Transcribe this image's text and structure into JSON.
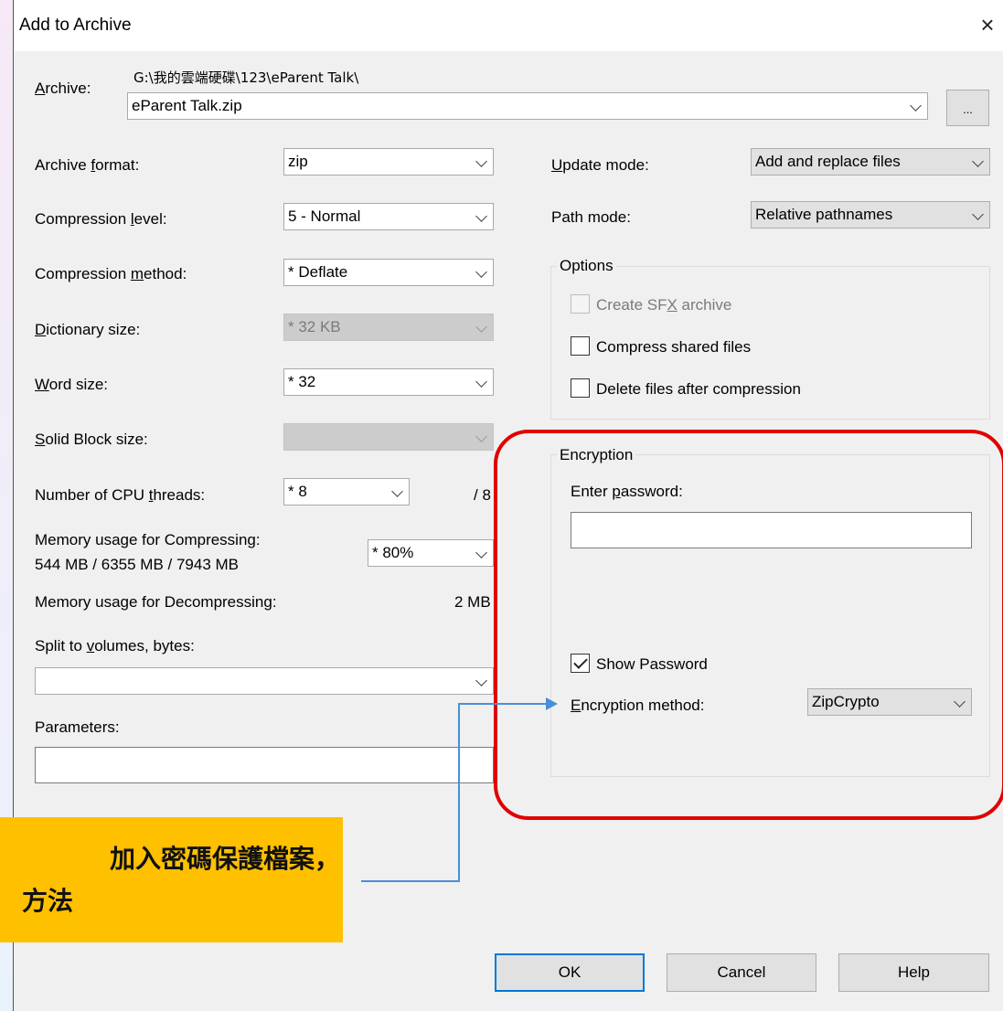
{
  "window": {
    "title": "Add to Archive",
    "close_glyph": "×"
  },
  "archive": {
    "label": "Archive:",
    "path": "G:\\我的雲端硬碟\\123\\eParent Talk\\",
    "filename": "eParent Talk.zip",
    "browse_label": "..."
  },
  "left": {
    "archive_format": {
      "label": "Archive format:",
      "value": "zip"
    },
    "compression_level": {
      "label": "Compression level:",
      "value": "5 - Normal"
    },
    "compression_method": {
      "label": "Compression method:",
      "value": "* Deflate"
    },
    "dictionary_size": {
      "label": "Dictionary size:",
      "value": "* 32 KB"
    },
    "word_size": {
      "label": "Word size:",
      "value": "* 32"
    },
    "solid_block_size": {
      "label": "Solid Block size:",
      "value": ""
    },
    "cpu_threads": {
      "label": "Number of CPU threads:",
      "value": "* 8",
      "max": "/ 8"
    },
    "memory_compress": {
      "label": "Memory usage for Compressing:",
      "detail": "544 MB / 6355 MB / 7943 MB",
      "value": "* 80%"
    },
    "memory_decompress": {
      "label": "Memory usage for Decompressing:",
      "value": "2 MB"
    },
    "split_volumes": {
      "label": "Split to volumes, bytes:",
      "value": ""
    },
    "parameters": {
      "label": "Parameters:",
      "value": ""
    }
  },
  "right": {
    "update_mode": {
      "label": "Update mode:",
      "value": "Add and replace files"
    },
    "path_mode": {
      "label": "Path mode:",
      "value": "Relative pathnames"
    },
    "options": {
      "title": "Options",
      "create_sfx": "Create SFX archive",
      "compress_shared": "Compress shared files",
      "delete_after": "Delete files after compression"
    },
    "encryption": {
      "title": "Encryption",
      "enter_password": "Enter password:",
      "password_value": "",
      "show_password": "Show Password",
      "method_label": "Encryption method:",
      "method_value": "ZipCrypto"
    }
  },
  "buttons": {
    "ok": "OK",
    "cancel": "Cancel",
    "help": "Help"
  },
  "callout": {
    "line1": "加入密碼保護檔案，",
    "line2": "方法"
  },
  "colors": {
    "highlight_red": "#e00000",
    "callout_yellow": "#ffc000",
    "arrow_blue": "#4a8ed8",
    "focus_blue": "#0078d7"
  }
}
